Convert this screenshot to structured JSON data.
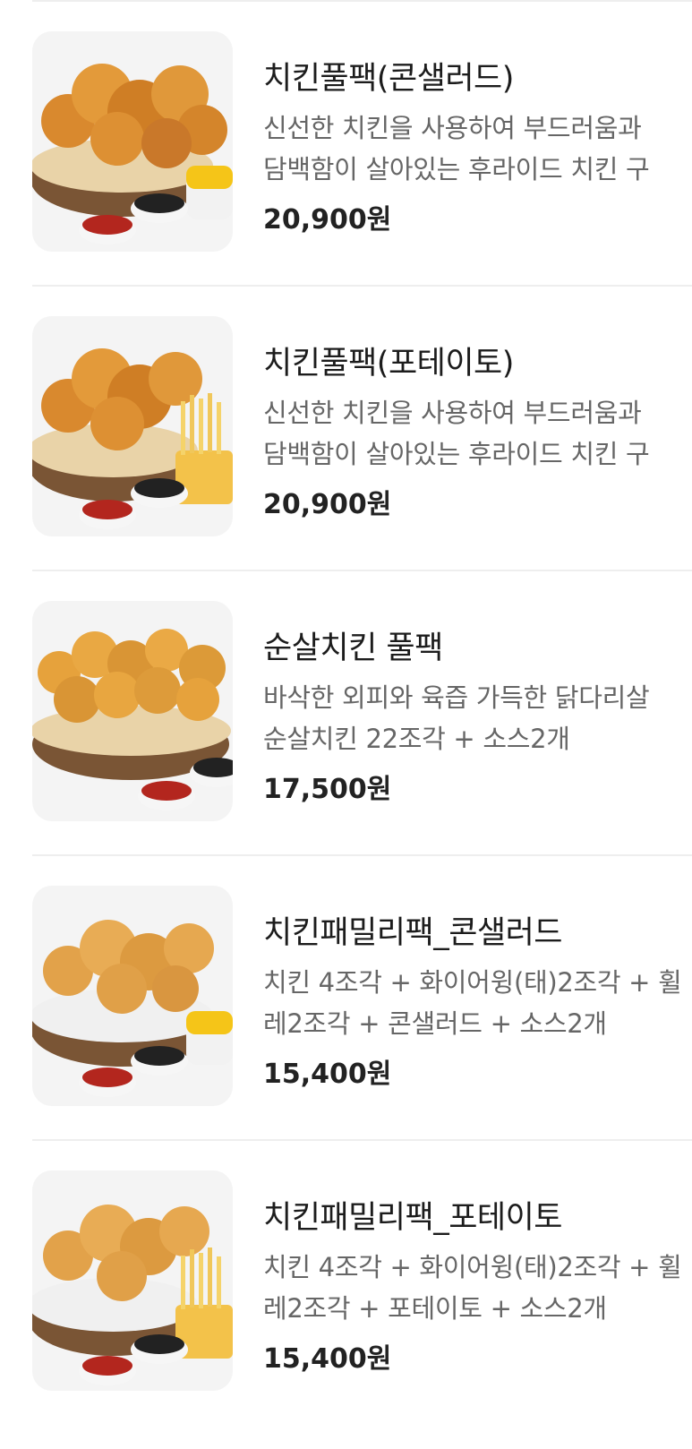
{
  "menu": {
    "items": [
      {
        "name": "치킨풀팩(콘샐러드)",
        "description_lines": [
          "신선한 치킨을 사용하여 부드러움과",
          "담백함이 살아있는 후라이드 치킨 구"
        ],
        "price": "20,900원",
        "image": "chicken-basket-corn-salad-icon"
      },
      {
        "name": "치킨풀팩(포테이토)",
        "description_lines": [
          "신선한 치킨을 사용하여 부드러움과",
          "담백함이 살아있는 후라이드 치킨 구"
        ],
        "price": "20,900원",
        "image": "chicken-basket-fries-icon"
      },
      {
        "name": "순살치킨 풀팩",
        "description_lines": [
          "바삭한 외피와 육즙 가득한 닭다리살",
          "순살치킨 22조각 + 소스2개"
        ],
        "price": "17,500원",
        "image": "boneless-chicken-basket-icon"
      },
      {
        "name": "치킨패밀리팩_콘샐러드",
        "description_lines": [
          "치킨 4조각 + 화이어윙(태)2조각 + 휠",
          "레2조각 + 콘샐러드 + 소스2개"
        ],
        "price": "15,400원",
        "image": "chicken-basket-corn-salad-icon"
      },
      {
        "name": "치킨패밀리팩_포테이토",
        "description_lines": [
          "치킨 4조각 + 화이어윙(태)2조각 + 휠",
          "레2조각 + 포테이토 + 소스2개"
        ],
        "price": "15,400원",
        "image": "chicken-basket-fries-icon"
      }
    ]
  },
  "colors": {
    "background": "#ffffff",
    "divider": "#eeeeee",
    "name_text": "#1c1c1c",
    "description_text": "#666666",
    "price_text": "#222222",
    "thumbnail_bg": "#f4f4f4"
  }
}
